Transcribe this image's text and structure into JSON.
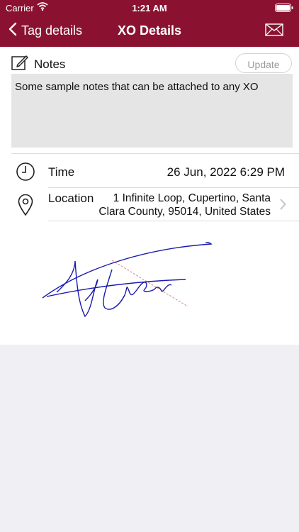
{
  "status_bar": {
    "carrier": "Carrier",
    "time": "1:21 AM"
  },
  "nav": {
    "back_label": "Tag details",
    "title": "XO Details"
  },
  "notes": {
    "label": "Notes",
    "update_label": "Update",
    "text": "Some sample notes that can be attached to any XO"
  },
  "details": {
    "time_label": "Time",
    "time_value": "26 Jun, 2022  6:29 PM",
    "location_label": "Location",
    "location_line1": "1 Infinite Loop, Cupertino, Santa",
    "location_line2": "Clara County, 95014, United States"
  },
  "colors": {
    "header": "#8a1230",
    "signature": "#1a1ab0",
    "background": "#efeff4"
  },
  "icons": [
    "wifi-icon",
    "battery-icon",
    "chevron-left-icon",
    "mail-icon",
    "edit-icon",
    "clock-icon",
    "location-pin-icon",
    "chevron-right-icon"
  ]
}
